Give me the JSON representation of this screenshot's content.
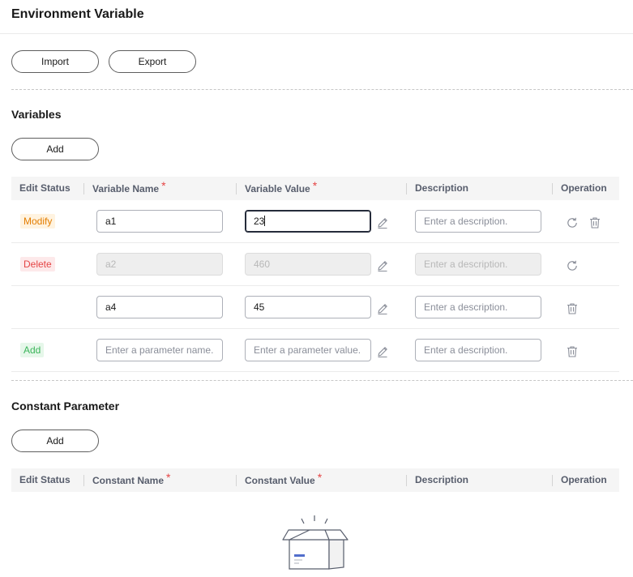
{
  "page": {
    "title": "Environment Variable"
  },
  "toolbar": {
    "import_label": "Import",
    "export_label": "Export"
  },
  "variables": {
    "title": "Variables",
    "add_label": "Add",
    "columns": {
      "edit_status": "Edit Status",
      "name": "Variable Name",
      "value": "Variable Value",
      "description": "Description",
      "operation": "Operation",
      "required_mark": "*"
    },
    "rows": [
      {
        "status": "Modify",
        "name": "a1",
        "value": "23",
        "description_placeholder": "Enter a description."
      },
      {
        "status": "Delete",
        "name": "a2",
        "value": "460",
        "description_placeholder": "Enter a description."
      },
      {
        "status": "",
        "name": "a4",
        "value": "45",
        "description_placeholder": "Enter a description."
      },
      {
        "status": "Add",
        "name_placeholder": "Enter a parameter name.",
        "value_placeholder": "Enter a parameter value.",
        "description_placeholder": "Enter a description."
      }
    ]
  },
  "constants": {
    "title": "Constant Parameter",
    "add_label": "Add",
    "columns": {
      "edit_status": "Edit Status",
      "name": "Constant Name",
      "value": "Constant Value",
      "description": "Description",
      "operation": "Operation",
      "required_mark": "*"
    }
  },
  "colors": {
    "modify_tag_bg": "#fff3e0",
    "modify_tag_text": "#e37d00",
    "delete_tag_bg": "#fde9ea",
    "delete_tag_text": "#e54545",
    "add_tag_bg": "#e6f7ea",
    "add_tag_text": "#3bb55a",
    "required": "#e54545"
  },
  "icons": [
    "edit-icon",
    "reset-icon",
    "trash-icon",
    "empty-box-icon"
  ]
}
